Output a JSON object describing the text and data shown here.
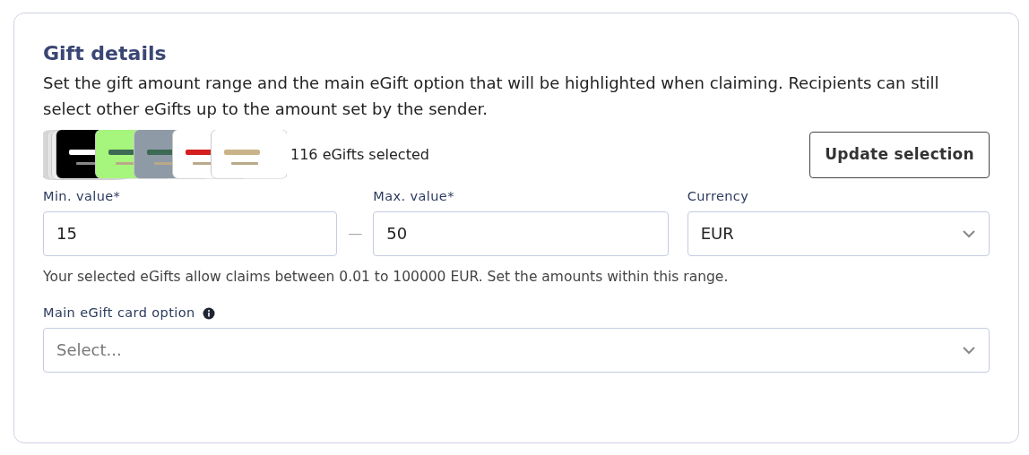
{
  "section": {
    "title": "Gift details",
    "description": "Set the gift amount range and the main eGift option that will be highlighted when claiming. Recipients can still select other eGifts up to the amount set by the sender."
  },
  "selected_count": "116 eGifts selected",
  "update_button": "Update selection",
  "min_value": {
    "label": "Min. value*",
    "value": "15"
  },
  "separator": "—",
  "max_value": {
    "label": "Max. value*",
    "value": "50"
  },
  "currency": {
    "label": "Currency",
    "value": "EUR"
  },
  "range_hint": "Your selected eGifts allow claims between 0.01 to 100000 EUR. Set the amounts within this range.",
  "main_option": {
    "label": "Main eGift card option",
    "placeholder": "Select..."
  }
}
